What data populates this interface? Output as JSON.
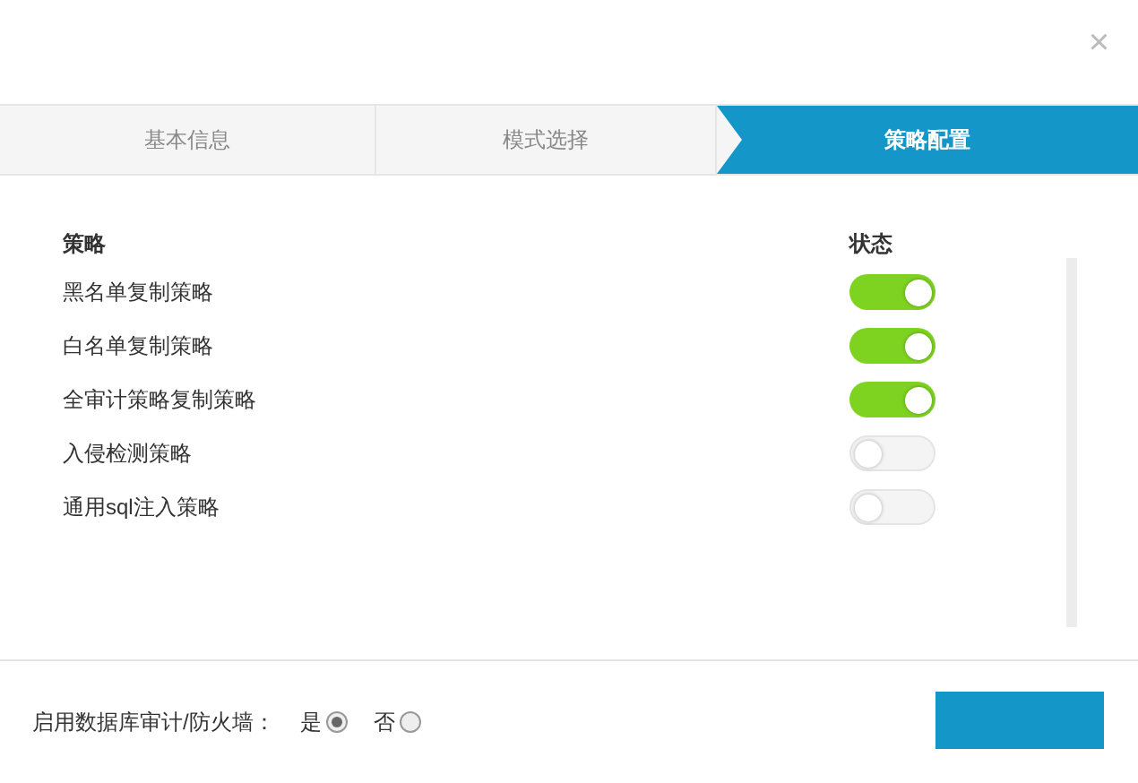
{
  "close": "×",
  "steps": [
    {
      "label": "基本信息",
      "selected": false
    },
    {
      "label": "模式选择",
      "selected": false
    },
    {
      "label": "策略配置",
      "selected": true
    }
  ],
  "table": {
    "columns": [
      "策略",
      "状态"
    ],
    "rows": [
      {
        "name": "黑名单复制策略",
        "on": true
      },
      {
        "name": "白名单复制策略",
        "on": true
      },
      {
        "name": "全审计策略复制策略",
        "on": true
      },
      {
        "name": "入侵检测策略",
        "on": false
      },
      {
        "name": "通用sql注入策略",
        "on": false
      }
    ]
  },
  "footer": {
    "label": "启用数据库审计/防火墙：",
    "options": [
      {
        "label": "是",
        "selected": true
      },
      {
        "label": "否",
        "selected": false
      }
    ]
  }
}
